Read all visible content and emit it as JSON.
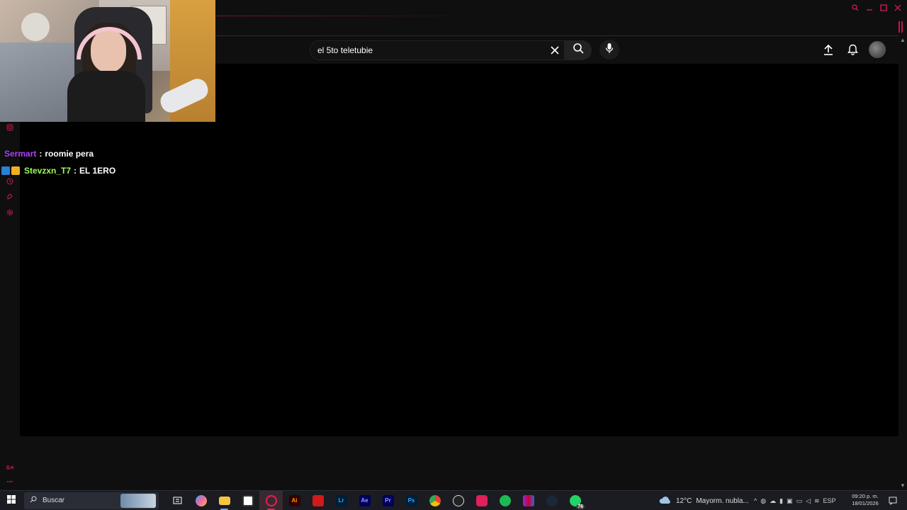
{
  "search": {
    "query": "el 5to teletubie"
  },
  "chat": [
    {
      "user": "Sermart",
      "sep": ":",
      "message": "roomie pera",
      "user_color": "#b040ff",
      "badges": []
    },
    {
      "user": "Stevzxn_T7",
      "sep": ":",
      "message": "EL 1ERO",
      "user_color": "#9cff5a",
      "badges": [
        "prime-badge-icon",
        "crown-badge-icon"
      ]
    }
  ],
  "taskbar": {
    "search_placeholder": "Buscar",
    "apps": [
      {
        "name": "task-view",
        "label": ""
      },
      {
        "name": "copilot",
        "label": ""
      },
      {
        "name": "file-explorer",
        "label": ""
      },
      {
        "name": "store",
        "label": ""
      },
      {
        "name": "opera-gx",
        "label": ""
      },
      {
        "name": "illustrator",
        "label": "Ai"
      },
      {
        "name": "acrobat",
        "label": ""
      },
      {
        "name": "lightroom",
        "label": "Lr"
      },
      {
        "name": "after-effects",
        "label": "Ae"
      },
      {
        "name": "premiere",
        "label": "Pr"
      },
      {
        "name": "photoshop",
        "label": "Ps"
      },
      {
        "name": "chrome",
        "label": ""
      },
      {
        "name": "obs",
        "label": ""
      },
      {
        "name": "record",
        "label": ""
      },
      {
        "name": "spotify",
        "label": ""
      },
      {
        "name": "winrar",
        "label": ""
      },
      {
        "name": "steam",
        "label": ""
      },
      {
        "name": "whatsapp",
        "label": ""
      }
    ],
    "whatsapp_count": "76",
    "weather_temp": "12°C",
    "weather_text": "Mayorm. nubla...",
    "language": "ESP",
    "time": "09:20 p. m.",
    "date": "18/01/2026"
  },
  "colors": {
    "accent": "#e0205a",
    "content_bg": "#000000",
    "chrome_bg": "#0f0f0f"
  }
}
